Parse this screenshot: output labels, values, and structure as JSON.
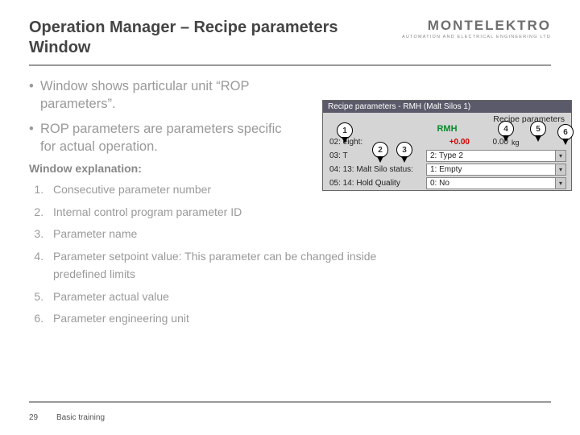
{
  "header": {
    "title": "Operation Manager – Recipe parameters Window",
    "logo_main": "MONTELEKTRO",
    "logo_sub": "AUTOMATION  AND  ELECTRICAL  ENGINEERING  LTD"
  },
  "bullets": [
    "Window shows particular unit “ROP parameters”.",
    "ROP parameters are parameters specific for actual operation."
  ],
  "explain_heading": "Window explanation:",
  "explain_items": [
    "Consecutive parameter number",
    "Internal control program parameter ID",
    "Parameter name",
    "Parameter setpoint value: This parameter can be changed inside predefined limits",
    "Parameter actual value",
    "Parameter engineering unit"
  ],
  "panel": {
    "titlebar": "Recipe parameters  - RMH  (Malt Silos 1)",
    "header": "Recipe parameters",
    "unit_code": "RMH",
    "rows": [
      {
        "label": "02:      eight:",
        "sp": "+0.00",
        "val": "0.00",
        "unit": "kg"
      },
      {
        "label": "03:          T",
        "dropdown": "2: Type 2"
      },
      {
        "label": "04: 13: Malt Silo status:",
        "dropdown": "1: Empty"
      },
      {
        "label": "05: 14: Hold Quality",
        "dropdown": "0: No"
      }
    ]
  },
  "callouts": {
    "c1": "1",
    "c2": "2",
    "c3": "3",
    "c4": "4",
    "c5": "5",
    "c6": "6"
  },
  "footer": {
    "page": "29",
    "label": "Basic training"
  }
}
